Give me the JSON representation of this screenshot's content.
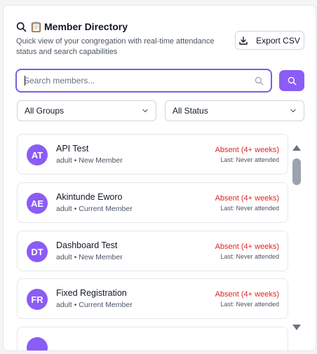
{
  "header": {
    "title": "Member Directory",
    "subtitle": "Quick view of your congregation with real-time attendance status and search capabilities",
    "export_label": "Export CSV"
  },
  "search": {
    "placeholder": "Search members...",
    "value": ""
  },
  "filters": {
    "group_selected": "All Groups",
    "status_selected": "All Status"
  },
  "members": [
    {
      "initials": "AT",
      "name": "API Test",
      "meta": "adult • New Member",
      "status": "Absent (4+ weeks)",
      "last": "Last: Never attended"
    },
    {
      "initials": "AE",
      "name": "Akintunde Eworo",
      "meta": "adult • Current Member",
      "status": "Absent (4+ weeks)",
      "last": "Last: Never attended"
    },
    {
      "initials": "DT",
      "name": "Dashboard Test",
      "meta": "adult • New Member",
      "status": "Absent (4+ weeks)",
      "last": "Last: Never attended"
    },
    {
      "initials": "FR",
      "name": "Fixed Registration",
      "meta": "adult • Current Member",
      "status": "Absent (4+ weeks)",
      "last": "Last: Never attended"
    },
    {
      "initials": "",
      "name": "",
      "meta": "",
      "status": "",
      "last": ""
    }
  ],
  "colors": {
    "accent": "#8b5cf6",
    "absent": "#dc2626"
  },
  "icons": {
    "title": "search-icon",
    "emoji": "clipboard-icon",
    "export": "download-icon",
    "search": "search-icon",
    "dropdown": "chevron-down-icon"
  }
}
